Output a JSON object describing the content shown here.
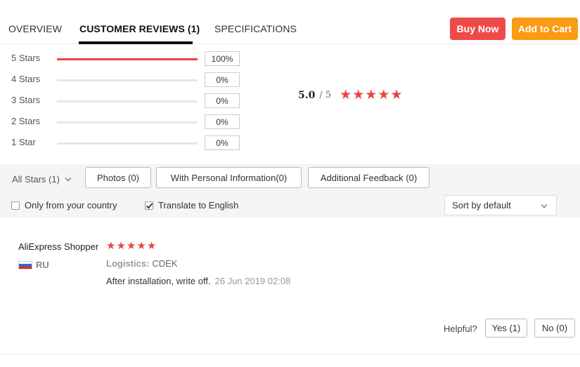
{
  "tabs": [
    {
      "label": "OVERVIEW",
      "active": false
    },
    {
      "label": "CUSTOMER REVIEWS (1)",
      "active": true
    },
    {
      "label": "SPECIFICATIONS",
      "active": false
    }
  ],
  "actions": {
    "buy_now": "Buy Now",
    "add_to_cart": "Add to Cart"
  },
  "colors": {
    "buy_now": "#ef4a4a",
    "add_to_cart": "#fb9a13",
    "star": "#e64545"
  },
  "rating_distribution": [
    {
      "label": "5 Stars",
      "percent": "100%",
      "fraction": 1.0
    },
    {
      "label": "4 Stars",
      "percent": "0%",
      "fraction": 0
    },
    {
      "label": "3 Stars",
      "percent": "0%",
      "fraction": 0
    },
    {
      "label": "2 Stars",
      "percent": "0%",
      "fraction": 0
    },
    {
      "label": "1 Star",
      "percent": "0%",
      "fraction": 0
    }
  ],
  "average": {
    "score": "5.0",
    "out_of": "/ 5",
    "stars": 5
  },
  "filters": {
    "all_stars": "All Stars (1)",
    "photos": "Photos (0)",
    "personal_info": "With Personal Information(0)",
    "additional_feedback": "Additional Feedback (0)",
    "only_country": {
      "label": "Only from your country",
      "checked": false
    },
    "translate": {
      "label": "Translate to English",
      "checked": true
    },
    "sort": "Sort by default"
  },
  "review": {
    "reviewer": "AliExpress Shopper",
    "stars": 5,
    "country": "RU",
    "flag_icon": "russia-flag-icon",
    "logistics_label": "Logistics:",
    "logistics_value": "CDEK",
    "text": "After installation, write off.",
    "date": "26 Jun 2019 02:08"
  },
  "helpful": {
    "label": "Helpful?",
    "yes": "Yes (1)",
    "no": "No (0)"
  }
}
